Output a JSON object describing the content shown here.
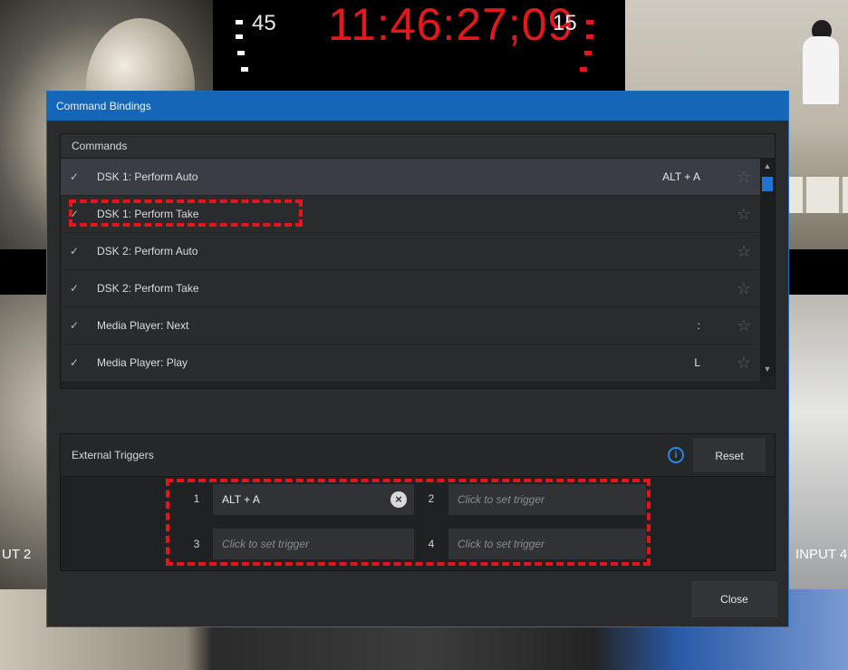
{
  "background": {
    "clock": {
      "time": "11:46:27;09",
      "left_seconds": "45",
      "right_seconds": "15"
    },
    "input_left_label": "UT 2",
    "input_right_label": "INPUT 4"
  },
  "dialog": {
    "title": "Command Bindings",
    "commands": {
      "header": "Commands",
      "items": [
        {
          "check": "✓",
          "label": "DSK 1: Perform Auto",
          "key": "ALT + A"
        },
        {
          "check": "✓",
          "label": "DSK 1: Perform Take",
          "key": ""
        },
        {
          "check": "✓",
          "label": "DSK 2: Perform Auto",
          "key": ""
        },
        {
          "check": "✓",
          "label": "DSK 2: Perform Take",
          "key": ""
        },
        {
          "check": "✓",
          "label": "Media Player: Next",
          "key": ":"
        },
        {
          "check": "✓",
          "label": "Media Player: Play",
          "key": "L"
        }
      ]
    },
    "triggers": {
      "header": "External Triggers",
      "reset_label": "Reset",
      "info_glyph": "i",
      "slots": [
        {
          "num": "1",
          "value": "ALT + A"
        },
        {
          "num": "2",
          "value": "Click to set trigger"
        },
        {
          "num": "3",
          "value": "Click to set trigger"
        },
        {
          "num": "4",
          "value": "Click to set trigger"
        }
      ]
    },
    "close_label": "Close"
  },
  "colors": {
    "accent": "#1666b8",
    "annotation": "#e8141a",
    "clock_red": "#e4181c"
  }
}
